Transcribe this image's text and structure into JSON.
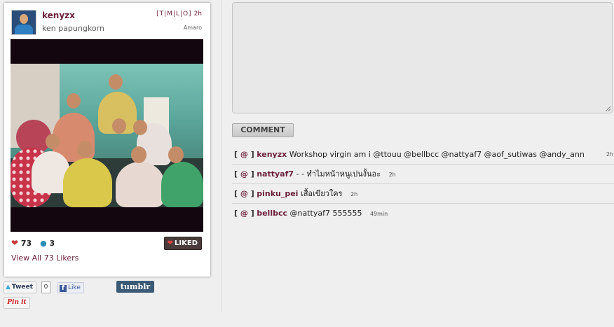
{
  "post": {
    "username": "kenyzx",
    "fullname": "ken papungkorn",
    "links": "[T|M|L|O]",
    "time": "2h",
    "filter": "Amaro",
    "likes": "73",
    "comments_count": "3",
    "liked_label": "LIKED",
    "view_all": "View All 73 Likers"
  },
  "share": {
    "tweet_label": "Tweet",
    "tweet_count": "0",
    "like_label": "Like",
    "tumblr_label": "tumblr",
    "pinit_label": "Pin it"
  },
  "comment_button": "COMMENT",
  "comments": [
    {
      "at": "@",
      "user": "kenyzx",
      "text": "Workshop virgin am i @ttouu @bellbcc @nattyaf7 @aof_sutiwas @andy_ann",
      "time": "2h"
    },
    {
      "at": "@",
      "user": "nattyaf7",
      "text": "- - ทำไมหน้าหนูเปนงั้นอะ",
      "time": "2h"
    },
    {
      "at": "@",
      "user": "pinku_pei",
      "text": "เสื้อเขียวใคร",
      "time": "2h"
    },
    {
      "at": "@",
      "user": "bellbcc",
      "text": "@nattyaf7 555555",
      "time": "49min"
    }
  ],
  "colors": {
    "accent": "#6b1f3a",
    "liked_bg": "#4a3c3c",
    "tumblr": "#3b5a76"
  }
}
